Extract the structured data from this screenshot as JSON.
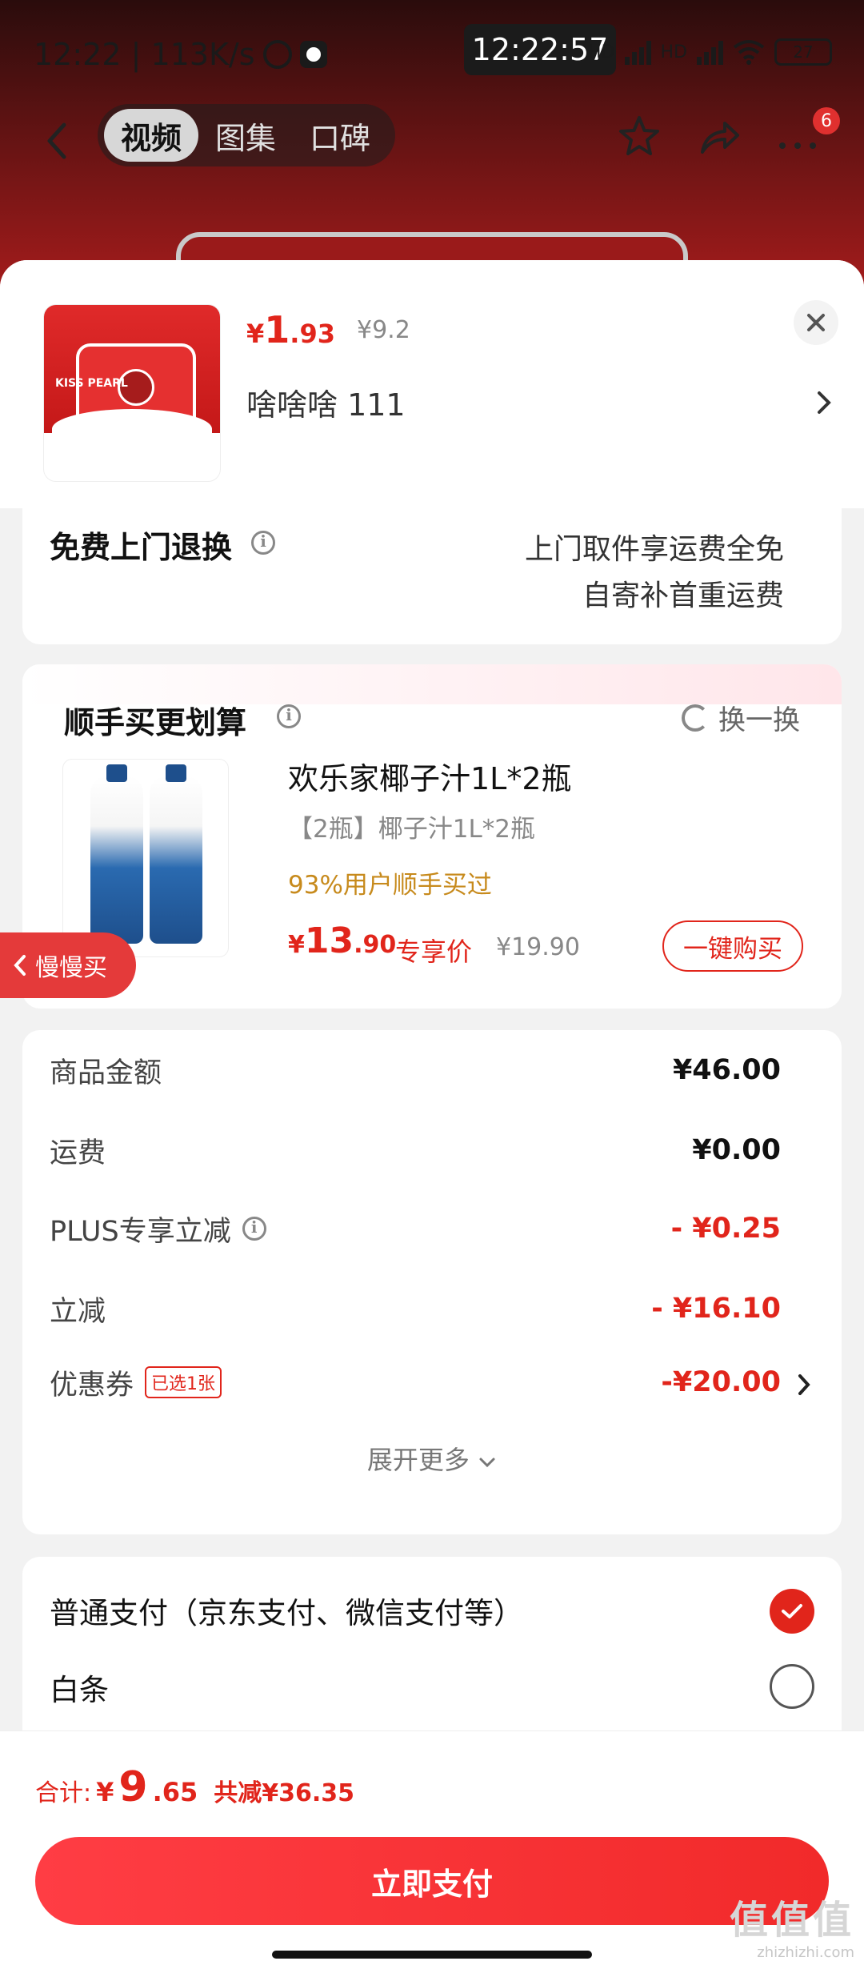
{
  "status_bar": {
    "left_text": "12:22 | 113K/s",
    "center_time": "12:22:57",
    "battery": "27",
    "network": "HD"
  },
  "nav": {
    "tabs": [
      {
        "label": "视频",
        "active": true
      },
      {
        "label": "图集",
        "active": false
      },
      {
        "label": "口碑",
        "active": false
      }
    ],
    "badge_count": "6"
  },
  "product": {
    "price_symbol": "¥",
    "price_int": "1",
    "price_dec": ".93",
    "original_price": "¥9.2",
    "spec": "啥啥啥  111",
    "image_brand_text": "KISS PEARL"
  },
  "returns": {
    "title": "免费上门退换",
    "line1": "上门取件享运费全免",
    "line2": "自寄补首重运费"
  },
  "addon": {
    "title": "顺手买更划算",
    "swap_label": "换一换",
    "floating_tag": "慢慢买",
    "item": {
      "name": "欢乐家椰子汁1L*2瓶",
      "sub": "【2瓶】椰子汁1L*2瓶",
      "bought_pct": "93%用户顺手买过",
      "price_symbol": "¥",
      "price_int": "13",
      "price_dec": ".90",
      "exclusive": "专享价",
      "original_price": "¥19.90",
      "buy_label": "一键购买"
    }
  },
  "summary": {
    "rows": [
      {
        "label": "商品金额",
        "value": "¥46.00",
        "red": false
      },
      {
        "label": "运费",
        "value": "¥0.00",
        "red": false
      },
      {
        "label": "PLUS专享立减",
        "value": "- ¥0.25",
        "red": true
      },
      {
        "label": "立减",
        "value": "- ¥16.10",
        "red": true
      },
      {
        "label": "优惠券",
        "value": "-¥20.00",
        "red": true
      }
    ],
    "coupon_chip": "已选1张",
    "expand_label": "展开更多"
  },
  "payment": {
    "options": [
      {
        "label": "普通支付（京东支付、微信支付等）",
        "selected": true
      },
      {
        "label": "白条",
        "selected": false
      }
    ]
  },
  "footer": {
    "total_label": "合计:",
    "total_symbol": "¥",
    "total_int": "9",
    "total_dec": ".65",
    "saved": "共减¥36.35",
    "pay_label": "立即支付",
    "watermark_big": "值值值",
    "watermark_small": "zhizhizhi.com"
  },
  "colors": {
    "accent_red": "#e1251b",
    "gold": "#c78a1c",
    "pay_button": "#f12a2a"
  }
}
